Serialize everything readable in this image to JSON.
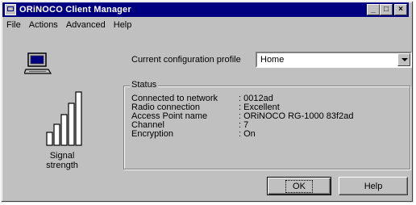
{
  "window": {
    "title": "ORiNOCO Client Manager",
    "controls": [
      "minimize",
      "maximize",
      "close"
    ]
  },
  "menu": {
    "items": [
      {
        "label": "File",
        "accel": "F"
      },
      {
        "label": "Actions",
        "accel": "A"
      },
      {
        "label": "Advanced",
        "accel": "d"
      },
      {
        "label": "Help",
        "accel": "H"
      }
    ]
  },
  "signal": {
    "label_line1": "Signal",
    "label_line2": "strength",
    "bars": 5,
    "icon": "laptop-icon"
  },
  "profile": {
    "label": "Current configuration profile",
    "value": "Home"
  },
  "status": {
    "title": "Status",
    "rows": [
      {
        "key": "Connected to network",
        "value": ": 0012ad"
      },
      {
        "key": "Radio connection",
        "value": ": Excellent"
      },
      {
        "key": "Access Point name",
        "value": ": ORiNOCO RG-1000 83f2ad"
      },
      {
        "key": "Channel",
        "value": ": 7"
      },
      {
        "key": "Encryption",
        "value": ": On"
      }
    ]
  },
  "buttons": {
    "ok": "OK",
    "help": "Help"
  }
}
